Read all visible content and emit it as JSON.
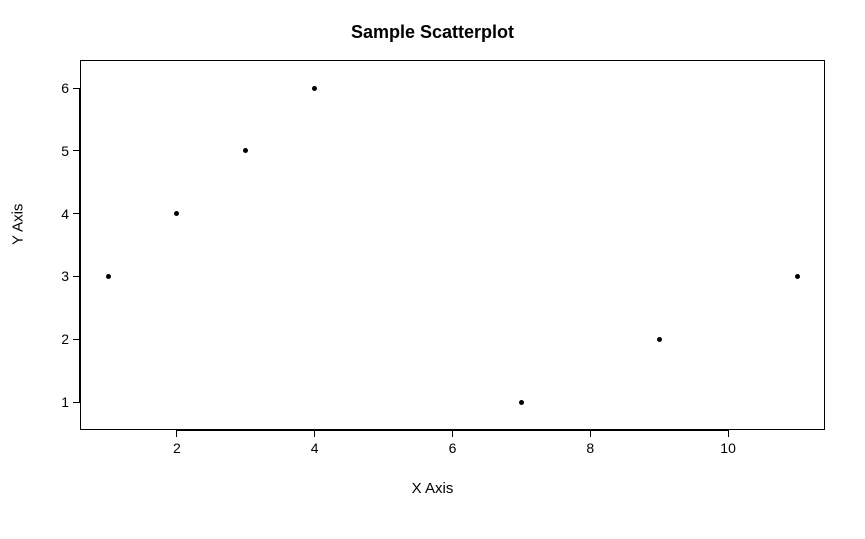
{
  "chart_data": {
    "type": "scatter",
    "title": "Sample Scatterplot",
    "xlabel": "X Axis",
    "ylabel": "Y Axis",
    "x": [
      1,
      2,
      3,
      4,
      7,
      9,
      11
    ],
    "y": [
      3,
      4,
      5,
      6,
      1,
      2,
      3
    ],
    "xlim": [
      1,
      11
    ],
    "ylim": [
      1,
      6
    ],
    "xticks": [
      2,
      4,
      6,
      8,
      10
    ],
    "yticks": [
      1,
      2,
      3,
      4,
      5,
      6
    ]
  }
}
